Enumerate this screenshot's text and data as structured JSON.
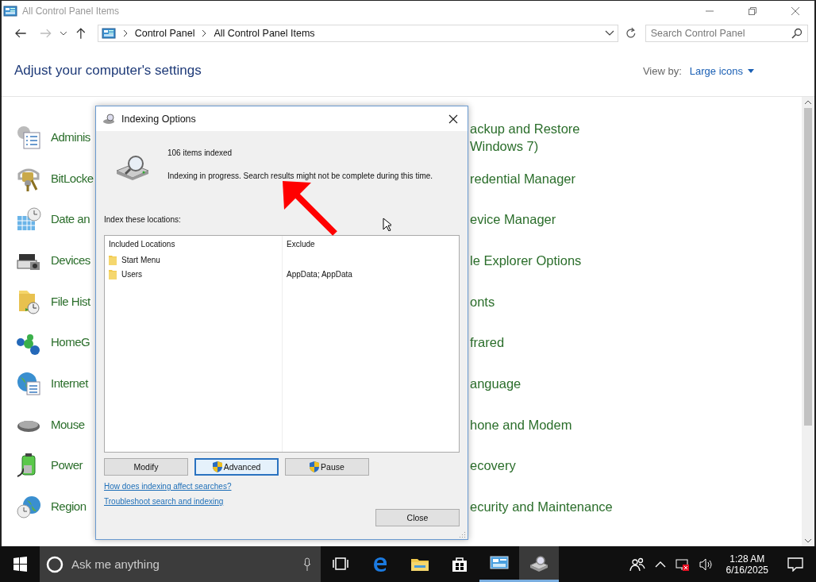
{
  "window": {
    "title": "All Control Panel Items"
  },
  "address": {
    "path": [
      "Control Panel",
      "All Control Panel Items"
    ]
  },
  "search": {
    "placeholder": "Search Control Panel"
  },
  "heading": "Adjust your computer's settings",
  "view_by": {
    "label": "View by:",
    "value": "Large icons"
  },
  "items_left": [
    {
      "label": "Adminis"
    },
    {
      "label": "BitLocke"
    },
    {
      "label": "Date an"
    },
    {
      "label": "Devices"
    },
    {
      "label": "File Hist"
    },
    {
      "label": "HomeG"
    },
    {
      "label": "Internet"
    },
    {
      "label": "Mouse"
    },
    {
      "label": "Power"
    },
    {
      "label": "Region"
    }
  ],
  "items_right": [
    {
      "lines": [
        "ackup and Restore",
        "Windows 7)"
      ]
    },
    {
      "lines": [
        "redential Manager"
      ]
    },
    {
      "lines": [
        "evice Manager"
      ]
    },
    {
      "lines": [
        "le Explorer Options"
      ]
    },
    {
      "lines": [
        "onts"
      ]
    },
    {
      "lines": [
        "frared"
      ]
    },
    {
      "lines": [
        "anguage"
      ]
    },
    {
      "lines": [
        "hone and Modem"
      ]
    },
    {
      "lines": [
        "ecovery"
      ]
    },
    {
      "lines": [
        "ecurity and Maintenance"
      ]
    }
  ],
  "dialog": {
    "title": "Indexing Options",
    "count": "106 items indexed",
    "status": "Indexing in progress. Search results might not be complete during this time.",
    "locations_label": "Index these locations:",
    "columns": [
      "Included Locations",
      "Exclude"
    ],
    "rows": [
      {
        "location": "Start Menu"
      },
      {
        "location": "Users",
        "exclude": "AppData; AppData"
      }
    ],
    "buttons": [
      {
        "label": "Modify",
        "shield": false,
        "focused": false
      },
      {
        "label": "Advanced",
        "shield": true,
        "focused": true
      },
      {
        "label": "Pause",
        "shield": true,
        "focused": false
      }
    ],
    "links": [
      "How does indexing affect searches?",
      "Troubleshoot search and indexing"
    ],
    "close_button": "Close"
  },
  "taskbar": {
    "search_placeholder": "Ask me anything",
    "apps": [
      {
        "kind": "taskview",
        "open": false,
        "selected": false
      },
      {
        "kind": "edge",
        "open": false,
        "selected": false
      },
      {
        "kind": "explorer",
        "open": false,
        "selected": false
      },
      {
        "kind": "store",
        "open": false,
        "selected": false
      },
      {
        "kind": "controlpanel",
        "open": true,
        "selected": false
      },
      {
        "kind": "indexing",
        "open": true,
        "selected": true
      }
    ],
    "time": "1:28 AM",
    "date": "6/16/2025"
  }
}
